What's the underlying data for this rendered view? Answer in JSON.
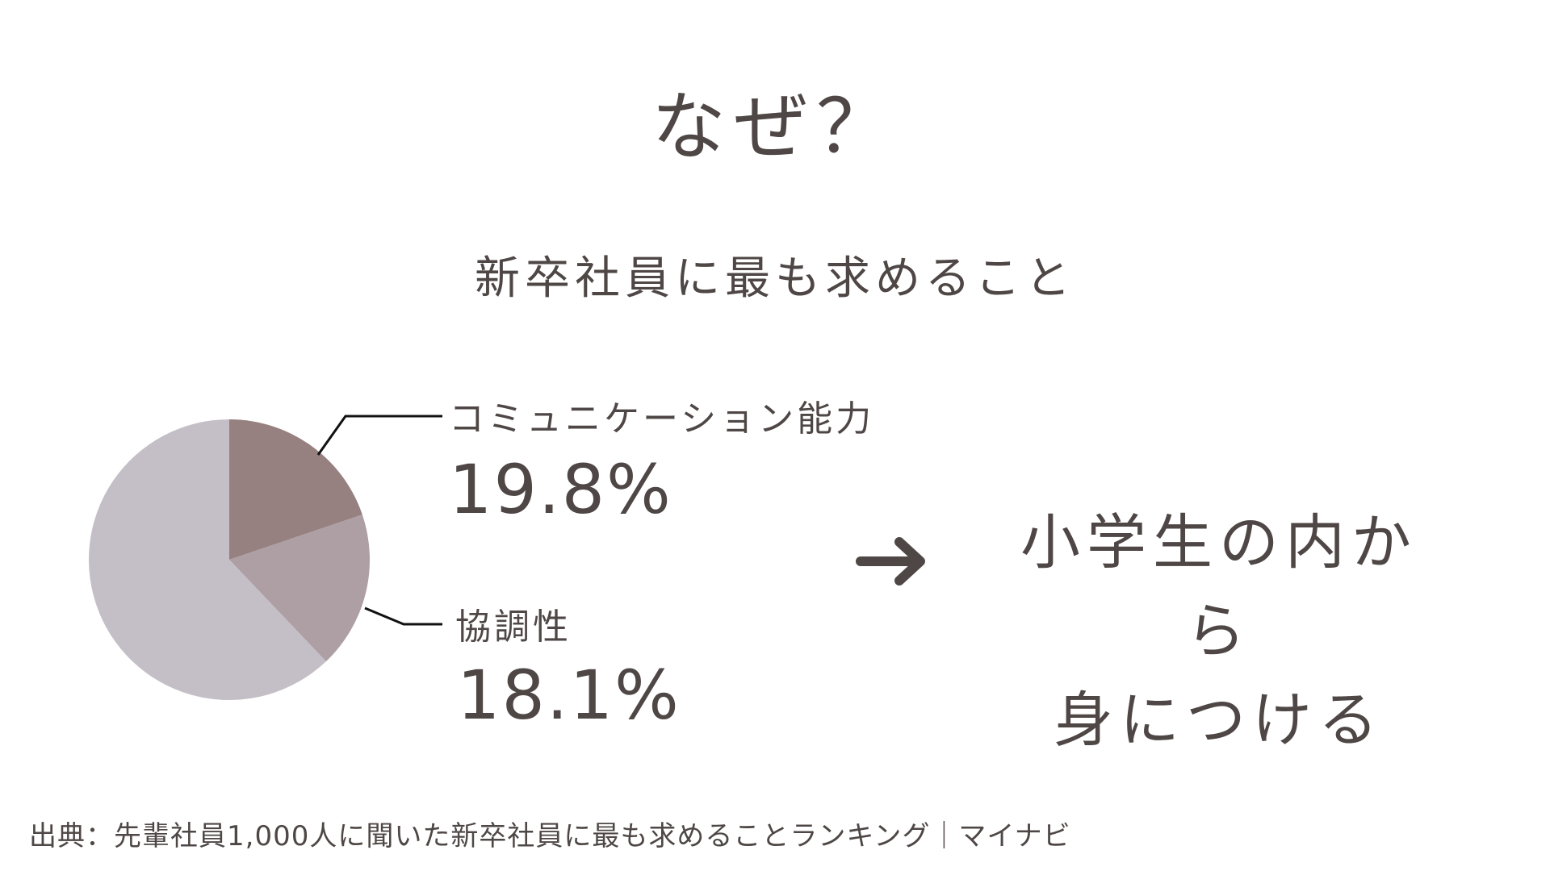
{
  "title": "なぜ？",
  "subtitle": "新卒社員に最も求めること",
  "chart_data": {
    "type": "pie",
    "slices": [
      {
        "label": "コミュニケーション能力",
        "value": 19.8,
        "display": "19.8%",
        "color": "#968080"
      },
      {
        "label": "協調性",
        "value": 18.1,
        "display": "18.1%",
        "color": "#ad9fa4"
      },
      {
        "label": "",
        "value": 62.1,
        "display": "",
        "color": "#c4bfc6"
      }
    ]
  },
  "conclusion": {
    "line1": "小学生の内から",
    "line2": "身につける"
  },
  "source": "出典：先輩社員1,000人に聞いた新卒社員に最も求めることランキング｜マイナビ",
  "colors": {
    "text": "#4e4745",
    "leader": "#111111"
  }
}
